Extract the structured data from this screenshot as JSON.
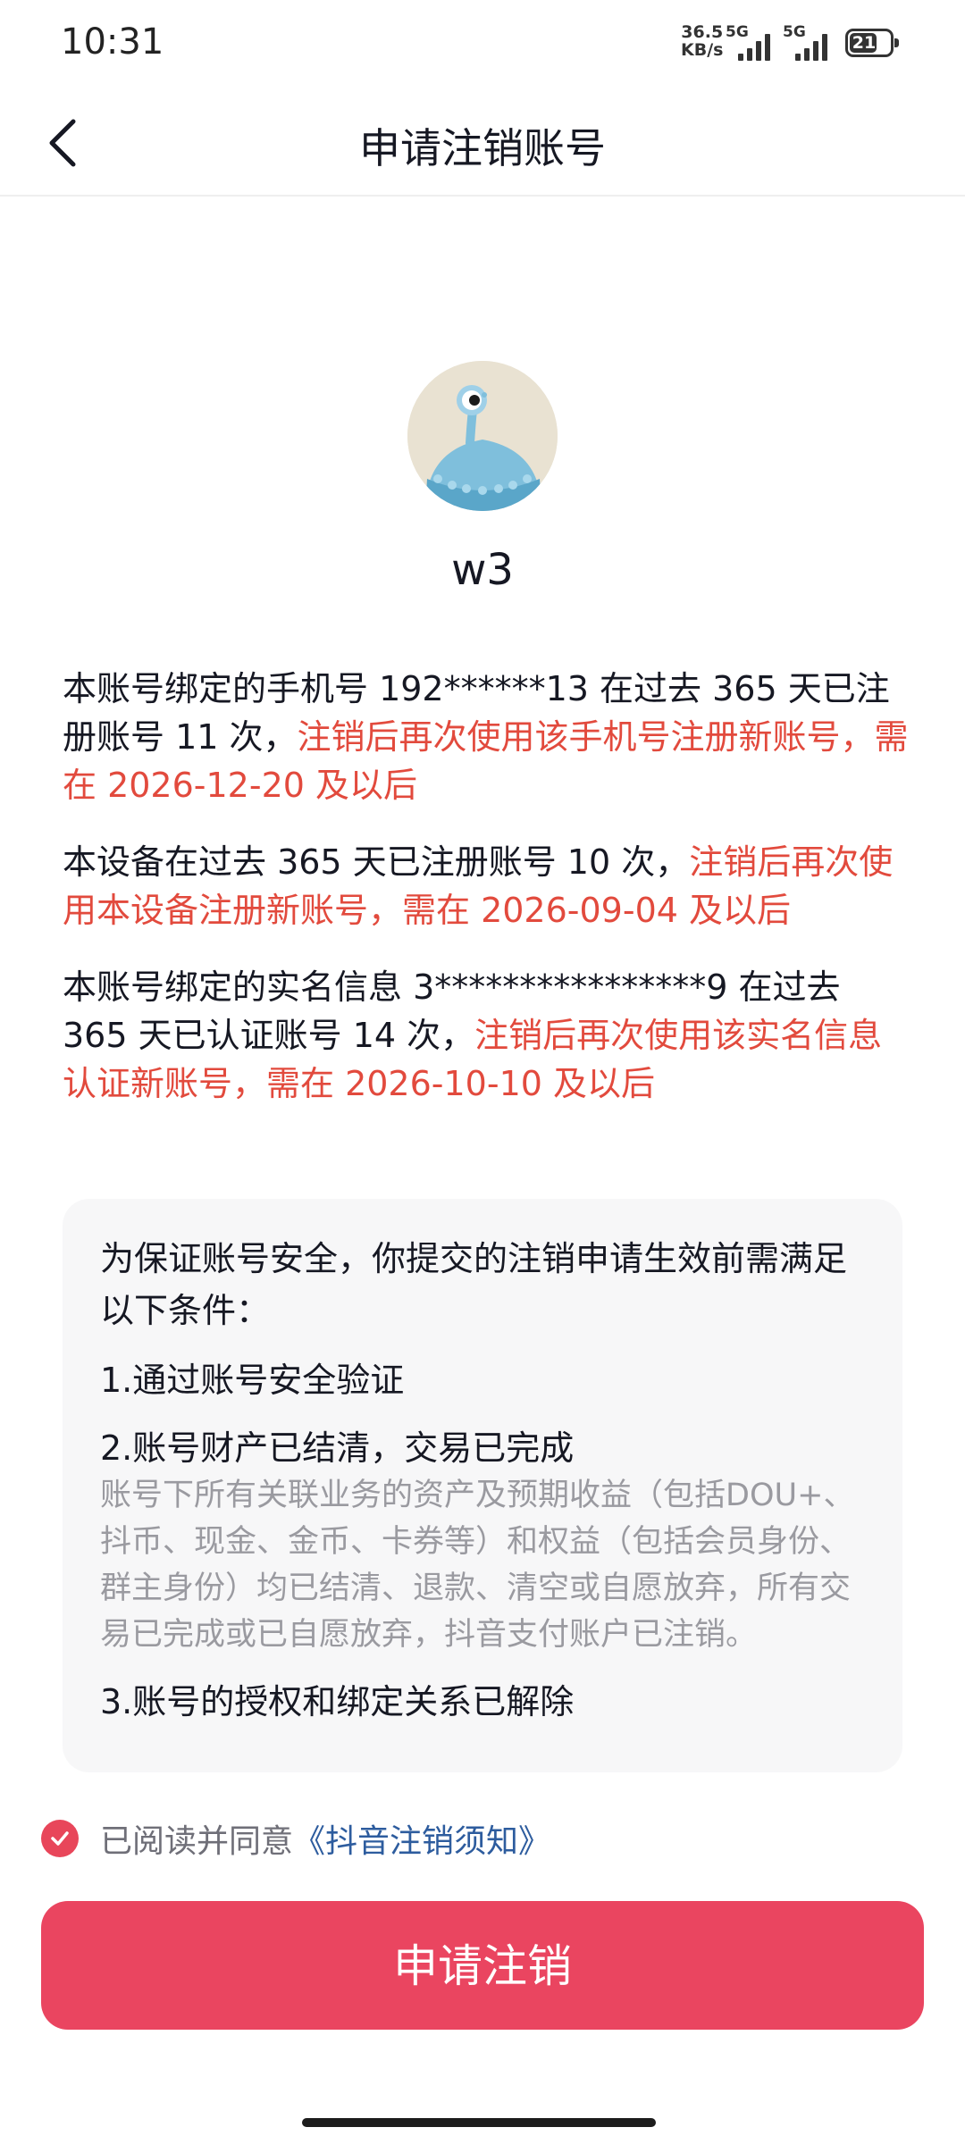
{
  "status_bar": {
    "time": "10:31",
    "net_speed_value": "36.5",
    "net_speed_unit": "KB/s",
    "signal1_label": "5G",
    "signal2_label": "5G",
    "battery": "21"
  },
  "nav": {
    "title": "申请注销账号",
    "back_icon": "chevron-left-icon"
  },
  "profile": {
    "username": "w3",
    "avatar_icon": "monster-avatar-icon"
  },
  "notices": [
    {
      "normal": "本账号绑定的手机号 192******13 在过去 365 天已注册账号 11 次，",
      "highlight": "注销后再次使用该手机号注册新账号，需在 2026-12-20 及以后"
    },
    {
      "normal": "本设备在过去 365 天已注册账号 10 次，",
      "highlight": "注销后再次使用本设备注册新账号，需在 2026-09-04 及以后"
    },
    {
      "normal": "本账号绑定的实名信息 3****************9 在过去 365 天已认证账号 14 次，",
      "highlight": "注销后再次使用该实名信息认证新账号，需在 2026-10-10 及以后"
    }
  ],
  "conditions": {
    "intro": "为保证账号安全，你提交的注销申请生效前需满足以下条件：",
    "item1": "1.通过账号安全验证",
    "item2": "2.账号财产已结清，交易已完成",
    "item2_desc": "账号下所有关联业务的资产及预期收益（包括DOU+、抖币、现金、金币、卡券等）和权益（包括会员身份、群主身份）均已结清、退款、清空或自愿放弃，所有交易已完成或已自愿放弃，抖音支付账户已注销。",
    "item3": "3.账号的授权和绑定关系已解除"
  },
  "agreement": {
    "checked": true,
    "text": "已阅读并同意",
    "link": "《抖音注销须知》"
  },
  "submit_label": "申请注销",
  "colors": {
    "accent": "#ea4560",
    "warning_text": "#e24a3d",
    "link": "#2d5c9e"
  }
}
